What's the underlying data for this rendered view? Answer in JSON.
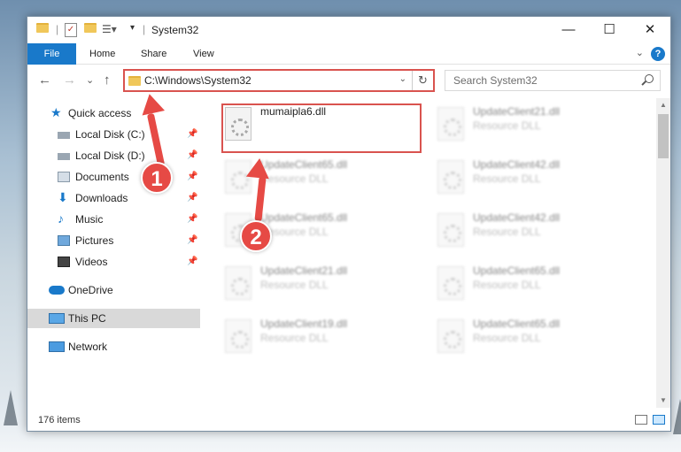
{
  "window": {
    "title": "System32",
    "controls": {
      "minimize": "—",
      "maximize": "☐",
      "close": "✕"
    }
  },
  "ribbon": {
    "file": "File",
    "tabs": [
      "Home",
      "Share",
      "View"
    ],
    "help": "?"
  },
  "navigation": {
    "back": "←",
    "forward": "→",
    "recent": "⌄",
    "up": "↑",
    "address": "C:\\Windows\\System32",
    "search_placeholder": "Search System32"
  },
  "sidebar": {
    "items": [
      {
        "label": "Quick access",
        "icon": "star-icon",
        "pinned": false
      },
      {
        "label": "Local Disk (C:)",
        "icon": "drive-icon",
        "pinned": true
      },
      {
        "label": "Local Disk (D:)",
        "icon": "drive-icon",
        "pinned": true
      },
      {
        "label": "Documents",
        "icon": "documents-icon",
        "pinned": true
      },
      {
        "label": "Downloads",
        "icon": "download-icon",
        "pinned": true
      },
      {
        "label": "Music",
        "icon": "music-icon",
        "pinned": true
      },
      {
        "label": "Pictures",
        "icon": "pictures-icon",
        "pinned": true
      },
      {
        "label": "Videos",
        "icon": "videos-icon",
        "pinned": true
      },
      {
        "label": "OneDrive",
        "icon": "cloud-icon",
        "pinned": false
      },
      {
        "label": "This PC",
        "icon": "computer-icon",
        "pinned": false
      },
      {
        "label": "Network",
        "icon": "network-icon",
        "pinned": false
      }
    ]
  },
  "files": [
    {
      "name": "mumaipla6.dll",
      "type": ""
    },
    {
      "name": "UpdateClient21.dll",
      "type": "Resource DLL"
    },
    {
      "name": "UpdateClient65.dll",
      "type": "Resource DLL"
    },
    {
      "name": "UpdateClient42.dll",
      "type": "Resource DLL"
    },
    {
      "name": "UpdateClient65.dll",
      "type": "Resource DLL"
    },
    {
      "name": "UpdateClient42.dll",
      "type": "Resource DLL"
    },
    {
      "name": "UpdateClient21.dll",
      "type": "Resource DLL"
    },
    {
      "name": "UpdateClient65.dll",
      "type": "Resource DLL"
    },
    {
      "name": "UpdateClient19.dll",
      "type": "Resource DLL"
    },
    {
      "name": "UpdateClient65.dll",
      "type": "Resource DLL"
    }
  ],
  "status": {
    "items_count": "176 items"
  },
  "annotations": {
    "step1": "1",
    "step2": "2",
    "color": "#e64a45"
  }
}
